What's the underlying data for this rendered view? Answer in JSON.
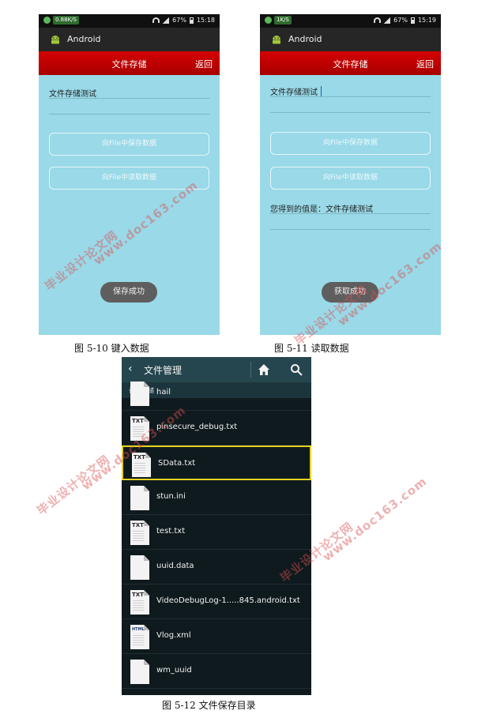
{
  "phone_left": {
    "status_speed": "0.88K/S",
    "status_battery": "67%",
    "status_time": "15:18",
    "app_name": "Android",
    "title": "文件存储",
    "back_label": "返回",
    "input_text": "文件存储测试",
    "save_button": "向File中保存数据",
    "read_button": "向File中读取数据",
    "toast": "保存成功"
  },
  "phone_right": {
    "status_speed": "1K/S",
    "status_battery": "67%",
    "status_time": "15:19",
    "app_name": "Android",
    "title": "文件存储",
    "back_label": "返回",
    "input_text": "文件存储测试",
    "save_button": "向File中保存数据",
    "read_button": "向File中读取数据",
    "result_text": "您得到的值是：文件存储测试",
    "toast": "获取成功"
  },
  "captions": {
    "fig10": "图 5-10 键入数据",
    "fig11": "图 5-11 读取数据",
    "fig12": "图 5-12 文件保存目录"
  },
  "file_manager": {
    "title": "文件管理",
    "section": "设备存储",
    "files": [
      {
        "name": "hail",
        "type": ""
      },
      {
        "name": "pinsecure_debug.txt",
        "type": "TXT"
      },
      {
        "name": "SData.txt",
        "type": "TXT",
        "selected": true
      },
      {
        "name": "stun.ini",
        "type": ""
      },
      {
        "name": "test.txt",
        "type": "TXT"
      },
      {
        "name": "uuid.data",
        "type": ""
      },
      {
        "name": "VideoDebugLog-1.....845.android.txt",
        "type": "TXT"
      },
      {
        "name": "Vlog.xml",
        "type": "HTML"
      },
      {
        "name": "wm_uuid",
        "type": ""
      }
    ]
  },
  "watermarks": {
    "text_cn": "毕业设计论文网",
    "text_url": "www.doc163.com"
  },
  "colors": {
    "phone_bg": "#99d9e8",
    "title_red": "#c80000",
    "fm_bg": "#0f1a1e",
    "fm_header": "#25464e",
    "selected_border": "#e6d21f"
  }
}
